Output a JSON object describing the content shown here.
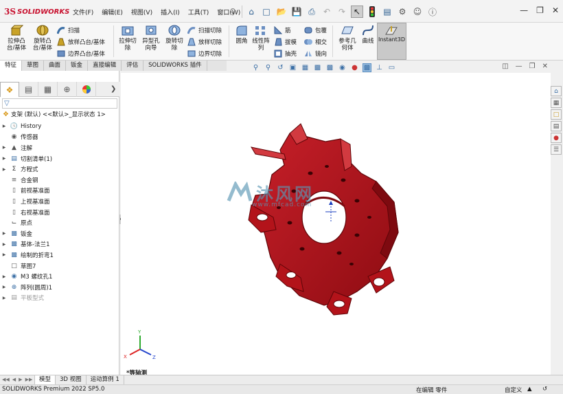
{
  "app": {
    "logo_mark": "3S",
    "logo_text": "SOLIDWORKS"
  },
  "menu": [
    "文件(F)",
    "编辑(E)",
    "视图(V)",
    "插入(I)",
    "工具(T)",
    "窗口(W)"
  ],
  "command_manager": {
    "extrude_boss": "拉伸凸\n台/基体",
    "revolve_boss": "旋转凸\n台/基体",
    "sweep": "扫描",
    "loft_boss": "放样凸台/基体",
    "boundary_boss": "边界凸台/基体",
    "extrude_cut": "拉伸切\n除",
    "hole_wizard": "异型孔\n向导",
    "revolve_cut": "旋转切\n除",
    "swept_cut": "扫描切除",
    "lofted_cut": "放样切除",
    "boundary_cut": "边界切除",
    "fillet": "圆角",
    "linear_pattern": "线性阵\n列",
    "rib": "筋",
    "draft": "拔模",
    "shell": "抽壳",
    "wrap": "包覆",
    "intersect": "相交",
    "mirror": "镜向",
    "ref_geometry": "参考几\n何体",
    "curves": "曲线",
    "instant3d": "Instant3D"
  },
  "tabs": [
    "特征",
    "草图",
    "曲面",
    "钣金",
    "直接编辑",
    "评估",
    "SOLIDWORKS 插件"
  ],
  "tree": {
    "root": "支架 (默认) <<默认>_显示状态 1>",
    "nodes": [
      {
        "label": "History",
        "icon": "history-icon",
        "expand": true
      },
      {
        "label": "传感器",
        "icon": "sensor-icon",
        "expand": false
      },
      {
        "label": "注解",
        "icon": "annotation-icon",
        "expand": true
      },
      {
        "label": "切割清单(1)",
        "icon": "cutlist-icon",
        "expand": true
      },
      {
        "label": "方程式",
        "icon": "equation-icon",
        "expand": true
      },
      {
        "label": "合金钢",
        "icon": "material-icon",
        "expand": false
      },
      {
        "label": "前视基准面",
        "icon": "plane-icon",
        "expand": false
      },
      {
        "label": "上视基准面",
        "icon": "plane-icon",
        "expand": false
      },
      {
        "label": "右视基准面",
        "icon": "plane-icon",
        "expand": false
      },
      {
        "label": "原点",
        "icon": "origin-icon",
        "expand": false
      },
      {
        "label": "钣金",
        "icon": "sheetmetal-icon",
        "expand": true
      },
      {
        "label": "基体-法兰1",
        "icon": "base-flange-icon",
        "expand": true
      },
      {
        "label": "绘制的折弯1",
        "icon": "sketched-bend-icon",
        "expand": true
      },
      {
        "label": "草图7",
        "icon": "sketch-icon",
        "expand": false
      },
      {
        "label": "M3 螺纹孔1",
        "icon": "hole-icon",
        "expand": true
      },
      {
        "label": "阵列(圆周)1",
        "icon": "circular-pattern-icon",
        "expand": true
      },
      {
        "label": "平板型式",
        "icon": "flat-pattern-icon",
        "expand": true,
        "dim": true
      }
    ]
  },
  "viewport": {
    "view_name": "*等轴测",
    "watermark_text": "沐风网",
    "watermark_url": "www.mfcad.com",
    "part_color": "#b3131a",
    "triad": {
      "x": "X",
      "y": "Y",
      "z": "Z"
    }
  },
  "bottom_tabs": [
    "模型",
    "3D 视图",
    "运动算例 1"
  ],
  "status": {
    "product": "SOLIDWORKS Premium 2022 SP5.0",
    "mode": "在编辑 零件",
    "units": "自定义"
  }
}
